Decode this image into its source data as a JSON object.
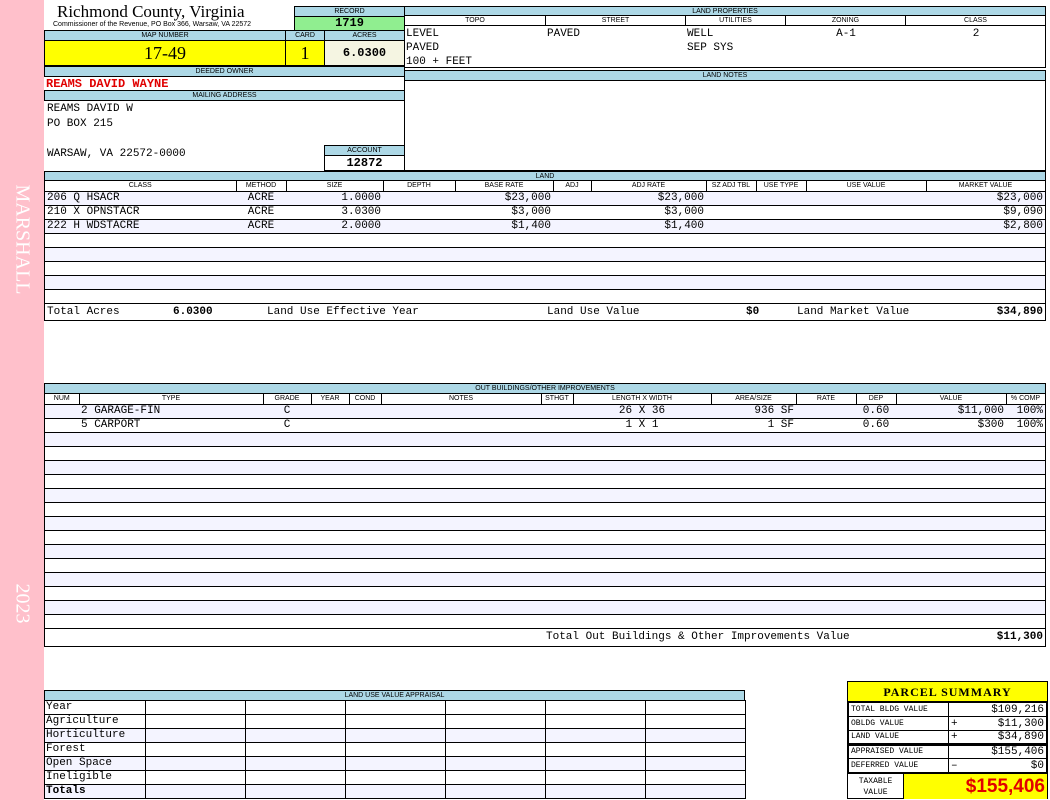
{
  "sidebar": {
    "owner_last": "MARSHALL",
    "year": "2023"
  },
  "header": {
    "title": "Richmond County, Virginia",
    "subtitle": "Commissioner of the Revenue, PO Box 366, Warsaw, VA 22572",
    "record_label": "RECORD",
    "record": "1719",
    "map_label": "MAP NUMBER",
    "map": "17-49",
    "card_label": "CARD",
    "card": "1",
    "acres_label": "ACRES",
    "acres": "6.0300",
    "owner_label": "DEEDED OWNER",
    "owner": "REAMS DAVID WAYNE",
    "mailing_label": "MAILING ADDRESS",
    "mailing": [
      "REAMS DAVID W",
      "PO BOX 215",
      "",
      "WARSAW, VA 22572-0000"
    ],
    "account_label": "ACCOUNT",
    "account": "12872"
  },
  "land_properties": {
    "title": "LAND PROPERTIES",
    "headers": [
      "TOPO",
      "STREET",
      "UTILITIES",
      "ZONING",
      "CLASS"
    ],
    "topo": [
      "LEVEL",
      "PAVED",
      "100 + FEET"
    ],
    "street": [
      "PAVED"
    ],
    "utilities": [
      "WELL",
      "SEP SYS"
    ],
    "zoning": "A-1",
    "class": "2",
    "notes_label": "LAND NOTES"
  },
  "land": {
    "title": "LAND",
    "headers": [
      "CLASS",
      "METHOD",
      "SIZE",
      "DEPTH",
      "BASE RATE",
      "ADJ",
      "ADJ RATE",
      "SZ ADJ TBL",
      "USE TYPE",
      "USE VALUE",
      "MARKET VALUE"
    ],
    "rows": [
      [
        "206 Q HSACR",
        "ACRE",
        "1.0000",
        "",
        "$23,000",
        "",
        "$23,000",
        "",
        "",
        "",
        "$23,000"
      ],
      [
        "210 X OPNSTACR",
        "ACRE",
        "3.0300",
        "",
        "$3,000",
        "",
        "$3,000",
        "",
        "",
        "",
        "$9,090"
      ],
      [
        "222 H WDSTACRE",
        "ACRE",
        "2.0000",
        "",
        "$1,400",
        "",
        "$1,400",
        "",
        "",
        "",
        "$2,800"
      ]
    ],
    "totals": {
      "acres_label": "Total Acres",
      "acres": "6.0300",
      "effective_year_label": "Land Use Effective Year",
      "use_value_label": "Land Use Value",
      "use_value": "$0",
      "market_label": "Land Market Value",
      "market": "$34,890"
    }
  },
  "outbuildings": {
    "title": "OUT BUILDINGS/OTHER IMPROVEMENTS",
    "headers": [
      "NUM",
      "TYPE",
      "GRADE",
      "YEAR",
      "COND",
      "NOTES",
      "STHGT",
      "LENGTH X WIDTH",
      "AREA/SIZE",
      "RATE",
      "DEP",
      "VALUE",
      "% COMP"
    ],
    "rows": [
      [
        "",
        "2  GARAGE-FIN",
        "C",
        "",
        "",
        "",
        "",
        "26 X 36",
        "936 SF",
        "",
        "0.60",
        "$11,000",
        "100%"
      ],
      [
        "",
        "5  CARPORT",
        "C",
        "",
        "",
        "",
        "",
        "1 X 1",
        "1 SF",
        "",
        "0.60",
        "$300",
        "100%"
      ]
    ],
    "total_label": "Total Out Buildings & Other Improvements Value",
    "total": "$11,300"
  },
  "land_use": {
    "title": "LAND USE VALUE APPRAISAL",
    "year_label": "Year",
    "rows": [
      "Agriculture",
      "Horticulture",
      "Forest",
      "Open Space",
      "Ineligible"
    ],
    "totals_label": "Totals"
  },
  "summary": {
    "title": "PARCEL SUMMARY",
    "rows": [
      {
        "label": "TOTAL BLDG VALUE",
        "sign": "",
        "value": "$109,216"
      },
      {
        "label": "OBLDG VALUE",
        "sign": "+",
        "value": "$11,300"
      },
      {
        "label": "LAND VALUE",
        "sign": "+",
        "value": "$34,890"
      },
      {
        "label": "APPRAISED VALUE",
        "sign": "",
        "value": "$155,406"
      },
      {
        "label": "DEFERRED VALUE",
        "sign": "–",
        "value": "$0"
      }
    ],
    "taxable_label": "TAXABLE VALUE",
    "taxable": "$155,406"
  },
  "colors": {
    "sidebar": "#ffc0cb",
    "header_bar": "#add8e6",
    "record": "#90ee90",
    "highlight": "#ffff00",
    "owner": "#e00000"
  }
}
